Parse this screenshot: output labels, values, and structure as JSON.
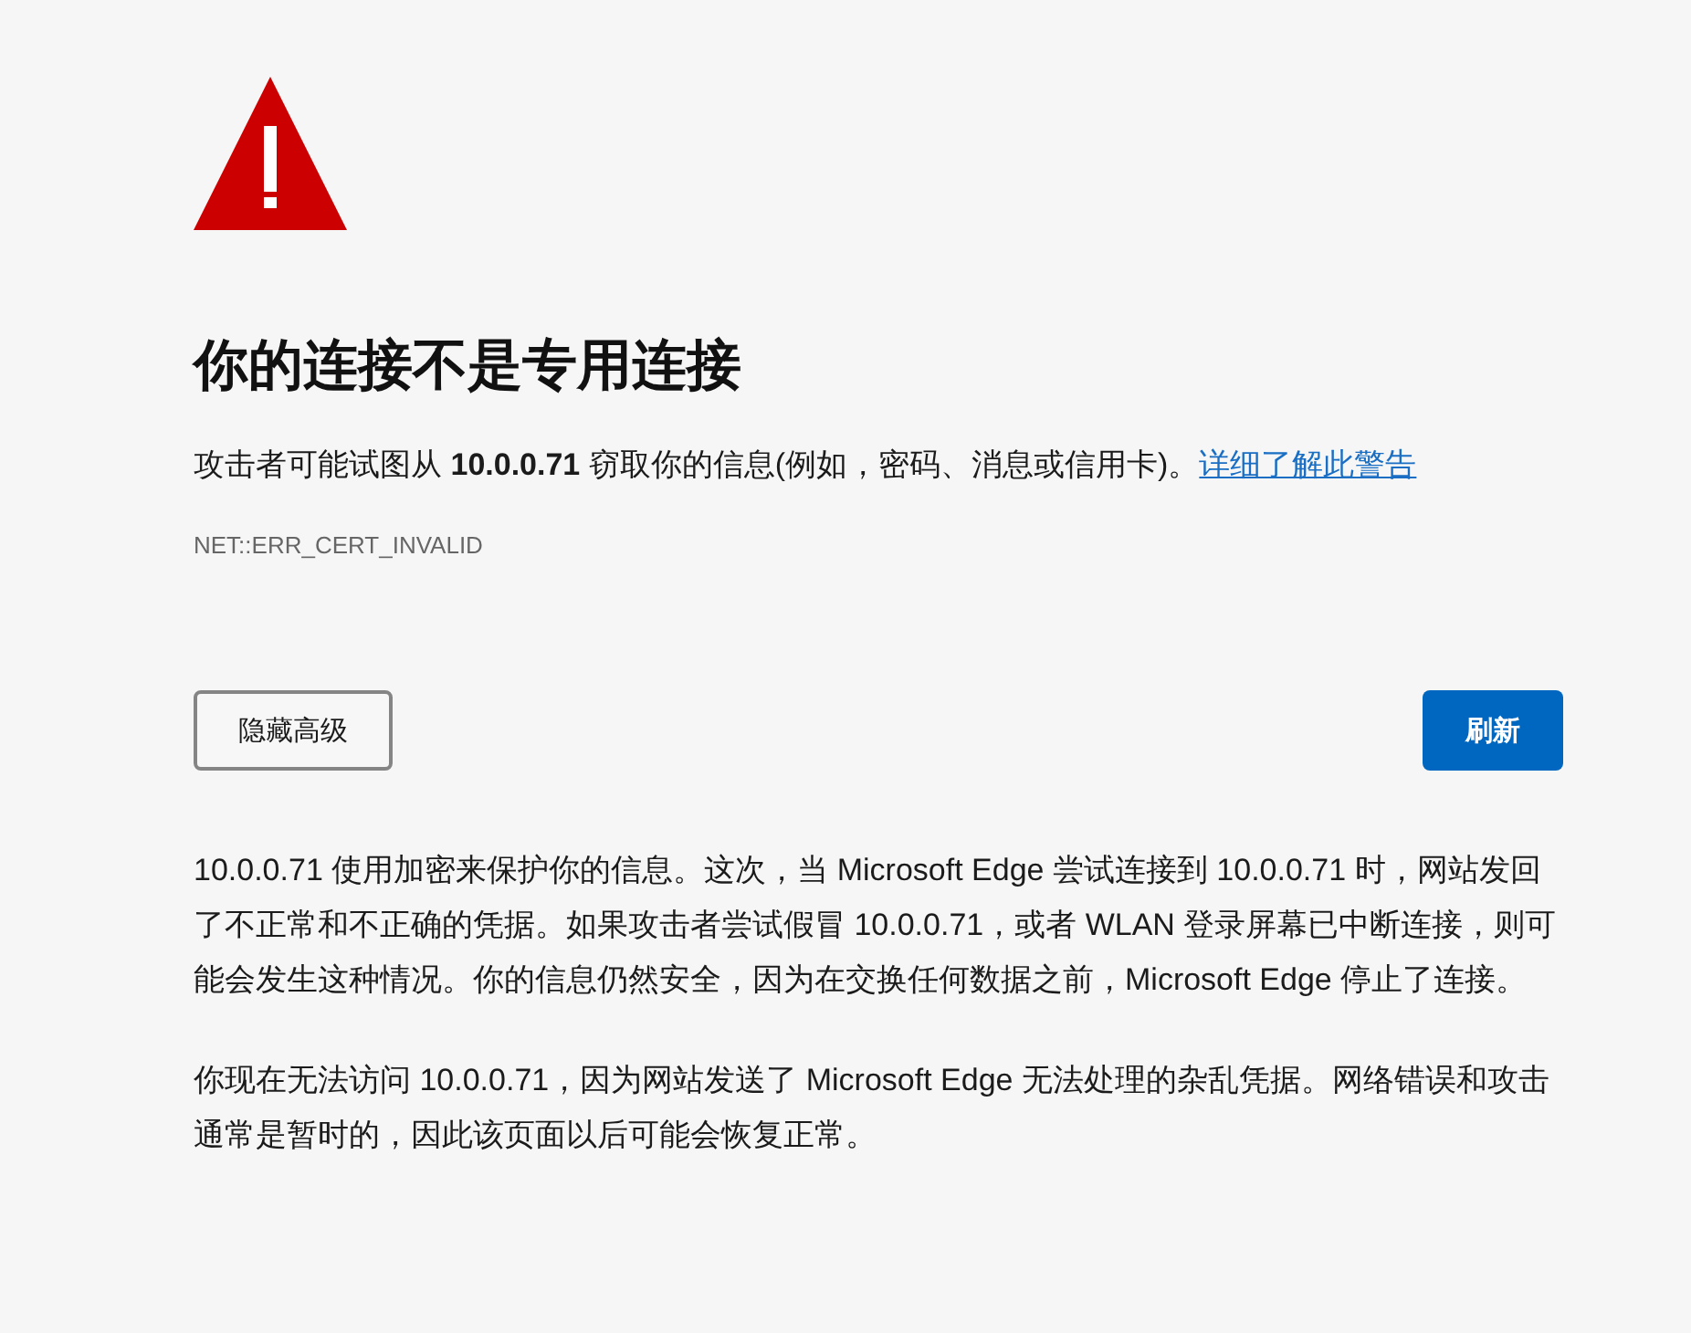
{
  "heading": "你的连接不是专用连接",
  "description": {
    "text": "攻击者可能试图从 **10.0.0.71** 窃取你的信息(例如，密码、消息或信用卡)。",
    "link": "详细了解此警告"
  },
  "error_code": "NET::ERR_CERT_INVALID",
  "buttons": [
    {
      "label": "隐藏高级",
      "kind": "secondary"
    },
    {
      "label": "刷新",
      "kind": "primary"
    }
  ],
  "details": [
    "10.0.0.71 使用加密来保护你的信息。这次，当 Microsoft Edge 尝试连接到 10.0.0.71 时，网站发回了不正常和不正确的凭据。如果攻击者尝试假冒 10.0.0.71，或者 WLAN 登录屏幕已中断连接，则可能会发生这种情况。你的信息仍然安全，因为在交换任何数据之前，Microsoft Edge 停止了连接。",
    "你现在无法访问 10.0.0.71，因为网站发送了 Microsoft Edge 无法处理的杂乱凭据。网络错误和攻击通常是暂时的，因此该页面以后可能会恢复正常。"
  ]
}
